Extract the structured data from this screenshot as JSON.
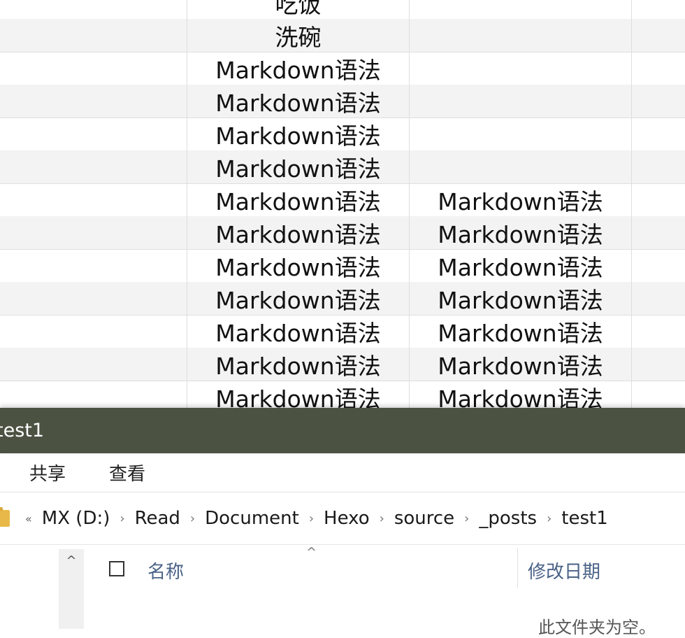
{
  "table": {
    "rows": [
      {
        "c1": "",
        "c2": "吃饭",
        "c3": "",
        "alt": false,
        "line": false
      },
      {
        "c1": "",
        "c2": "洗碗",
        "c3": "",
        "alt": true,
        "line": false
      },
      {
        "c1": "",
        "c2": "Markdown语法",
        "c3": "",
        "alt": false,
        "line": true
      },
      {
        "c1": "",
        "c2": "Markdown语法",
        "c3": "",
        "alt": true,
        "line": false
      },
      {
        "c1": "",
        "c2": "Markdown语法",
        "c3": "",
        "alt": false,
        "line": true
      },
      {
        "c1": "",
        "c2": "Markdown语法",
        "c3": "",
        "alt": true,
        "line": false
      },
      {
        "c1": "",
        "c2": "Markdown语法",
        "c3": "Markdown语法",
        "alt": false,
        "line": true
      },
      {
        "c1": "",
        "c2": "Markdown语法",
        "c3": "Markdown语法",
        "alt": true,
        "line": false
      },
      {
        "c1": "",
        "c2": "Markdown语法",
        "c3": "Markdown语法",
        "alt": false,
        "line": true
      },
      {
        "c1": "",
        "c2": "Markdown语法",
        "c3": "Markdown语法",
        "alt": true,
        "line": false
      },
      {
        "c1": "",
        "c2": "Markdown语法",
        "c3": "Markdown语法",
        "alt": false,
        "line": true
      },
      {
        "c1": "",
        "c2": "Markdown语法",
        "c3": "Markdown语法",
        "alt": true,
        "line": false
      },
      {
        "c1": "",
        "c2": "Markdown语法",
        "c3": "Markdown语法",
        "alt": false,
        "line": true
      }
    ]
  },
  "explorer": {
    "title": "test1",
    "ribbon_tabs": [
      "共享",
      "查看"
    ],
    "overflow_glyph": "«",
    "breadcrumbs": [
      "MX (D:)",
      "Read",
      "Document",
      "Hexo",
      "source",
      "_posts",
      "test1"
    ],
    "breadcrumb_separator": "›",
    "columns": {
      "name": "名称",
      "modified": "修改日期"
    },
    "empty_message": "此文件夹为空。",
    "sort_glyph": "^",
    "scroll_up_glyph": "^",
    "colors": {
      "titlebar": "#4b5242",
      "column_header": "#4a6287",
      "folder": "#e8b948"
    }
  }
}
